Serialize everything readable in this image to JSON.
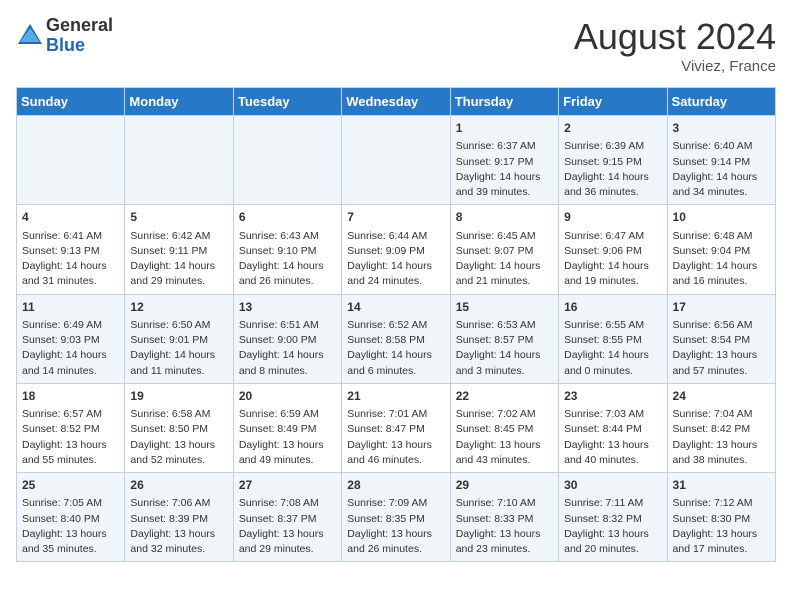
{
  "header": {
    "logo_line1": "General",
    "logo_line2": "Blue",
    "month_year": "August 2024",
    "location": "Viviez, France"
  },
  "days_of_week": [
    "Sunday",
    "Monday",
    "Tuesday",
    "Wednesday",
    "Thursday",
    "Friday",
    "Saturday"
  ],
  "weeks": [
    [
      {
        "day": "",
        "info": ""
      },
      {
        "day": "",
        "info": ""
      },
      {
        "day": "",
        "info": ""
      },
      {
        "day": "",
        "info": ""
      },
      {
        "day": "1",
        "info": "Sunrise: 6:37 AM\nSunset: 9:17 PM\nDaylight: 14 hours and 39 minutes."
      },
      {
        "day": "2",
        "info": "Sunrise: 6:39 AM\nSunset: 9:15 PM\nDaylight: 14 hours and 36 minutes."
      },
      {
        "day": "3",
        "info": "Sunrise: 6:40 AM\nSunset: 9:14 PM\nDaylight: 14 hours and 34 minutes."
      }
    ],
    [
      {
        "day": "4",
        "info": "Sunrise: 6:41 AM\nSunset: 9:13 PM\nDaylight: 14 hours and 31 minutes."
      },
      {
        "day": "5",
        "info": "Sunrise: 6:42 AM\nSunset: 9:11 PM\nDaylight: 14 hours and 29 minutes."
      },
      {
        "day": "6",
        "info": "Sunrise: 6:43 AM\nSunset: 9:10 PM\nDaylight: 14 hours and 26 minutes."
      },
      {
        "day": "7",
        "info": "Sunrise: 6:44 AM\nSunset: 9:09 PM\nDaylight: 14 hours and 24 minutes."
      },
      {
        "day": "8",
        "info": "Sunrise: 6:45 AM\nSunset: 9:07 PM\nDaylight: 14 hours and 21 minutes."
      },
      {
        "day": "9",
        "info": "Sunrise: 6:47 AM\nSunset: 9:06 PM\nDaylight: 14 hours and 19 minutes."
      },
      {
        "day": "10",
        "info": "Sunrise: 6:48 AM\nSunset: 9:04 PM\nDaylight: 14 hours and 16 minutes."
      }
    ],
    [
      {
        "day": "11",
        "info": "Sunrise: 6:49 AM\nSunset: 9:03 PM\nDaylight: 14 hours and 14 minutes."
      },
      {
        "day": "12",
        "info": "Sunrise: 6:50 AM\nSunset: 9:01 PM\nDaylight: 14 hours and 11 minutes."
      },
      {
        "day": "13",
        "info": "Sunrise: 6:51 AM\nSunset: 9:00 PM\nDaylight: 14 hours and 8 minutes."
      },
      {
        "day": "14",
        "info": "Sunrise: 6:52 AM\nSunset: 8:58 PM\nDaylight: 14 hours and 6 minutes."
      },
      {
        "day": "15",
        "info": "Sunrise: 6:53 AM\nSunset: 8:57 PM\nDaylight: 14 hours and 3 minutes."
      },
      {
        "day": "16",
        "info": "Sunrise: 6:55 AM\nSunset: 8:55 PM\nDaylight: 14 hours and 0 minutes."
      },
      {
        "day": "17",
        "info": "Sunrise: 6:56 AM\nSunset: 8:54 PM\nDaylight: 13 hours and 57 minutes."
      }
    ],
    [
      {
        "day": "18",
        "info": "Sunrise: 6:57 AM\nSunset: 8:52 PM\nDaylight: 13 hours and 55 minutes."
      },
      {
        "day": "19",
        "info": "Sunrise: 6:58 AM\nSunset: 8:50 PM\nDaylight: 13 hours and 52 minutes."
      },
      {
        "day": "20",
        "info": "Sunrise: 6:59 AM\nSunset: 8:49 PM\nDaylight: 13 hours and 49 minutes."
      },
      {
        "day": "21",
        "info": "Sunrise: 7:01 AM\nSunset: 8:47 PM\nDaylight: 13 hours and 46 minutes."
      },
      {
        "day": "22",
        "info": "Sunrise: 7:02 AM\nSunset: 8:45 PM\nDaylight: 13 hours and 43 minutes."
      },
      {
        "day": "23",
        "info": "Sunrise: 7:03 AM\nSunset: 8:44 PM\nDaylight: 13 hours and 40 minutes."
      },
      {
        "day": "24",
        "info": "Sunrise: 7:04 AM\nSunset: 8:42 PM\nDaylight: 13 hours and 38 minutes."
      }
    ],
    [
      {
        "day": "25",
        "info": "Sunrise: 7:05 AM\nSunset: 8:40 PM\nDaylight: 13 hours and 35 minutes."
      },
      {
        "day": "26",
        "info": "Sunrise: 7:06 AM\nSunset: 8:39 PM\nDaylight: 13 hours and 32 minutes."
      },
      {
        "day": "27",
        "info": "Sunrise: 7:08 AM\nSunset: 8:37 PM\nDaylight: 13 hours and 29 minutes."
      },
      {
        "day": "28",
        "info": "Sunrise: 7:09 AM\nSunset: 8:35 PM\nDaylight: 13 hours and 26 minutes."
      },
      {
        "day": "29",
        "info": "Sunrise: 7:10 AM\nSunset: 8:33 PM\nDaylight: 13 hours and 23 minutes."
      },
      {
        "day": "30",
        "info": "Sunrise: 7:11 AM\nSunset: 8:32 PM\nDaylight: 13 hours and 20 minutes."
      },
      {
        "day": "31",
        "info": "Sunrise: 7:12 AM\nSunset: 8:30 PM\nDaylight: 13 hours and 17 minutes."
      }
    ]
  ]
}
